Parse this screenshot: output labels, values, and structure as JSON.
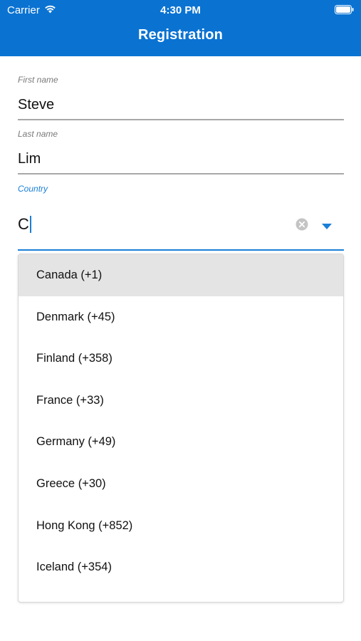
{
  "status_bar": {
    "carrier": "Carrier",
    "time": "4:30 PM"
  },
  "nav": {
    "title": "Registration"
  },
  "form": {
    "first_name": {
      "label": "First name",
      "value": "Steve"
    },
    "last_name": {
      "label": "Last name",
      "value": "Lim"
    },
    "country": {
      "label": "Country",
      "value": "C"
    }
  },
  "dropdown": {
    "items": [
      {
        "label": "Canada (+1)",
        "highlighted": true
      },
      {
        "label": "Denmark (+45)"
      },
      {
        "label": "Finland (+358)"
      },
      {
        "label": "France (+33)"
      },
      {
        "label": "Germany (+49)"
      },
      {
        "label": "Greece (+30)"
      },
      {
        "label": "Hong Kong (+852)"
      },
      {
        "label": "Iceland (+354)"
      }
    ]
  },
  "icons": {
    "wifi": "wifi-icon",
    "battery": "battery-icon",
    "clear": "clear-icon",
    "dropdown": "dropdown-arrow-icon"
  },
  "colors": {
    "header_background": "#0a73d2",
    "accent": "#1a7fd6",
    "highlight_row": "#e4e4e4"
  }
}
